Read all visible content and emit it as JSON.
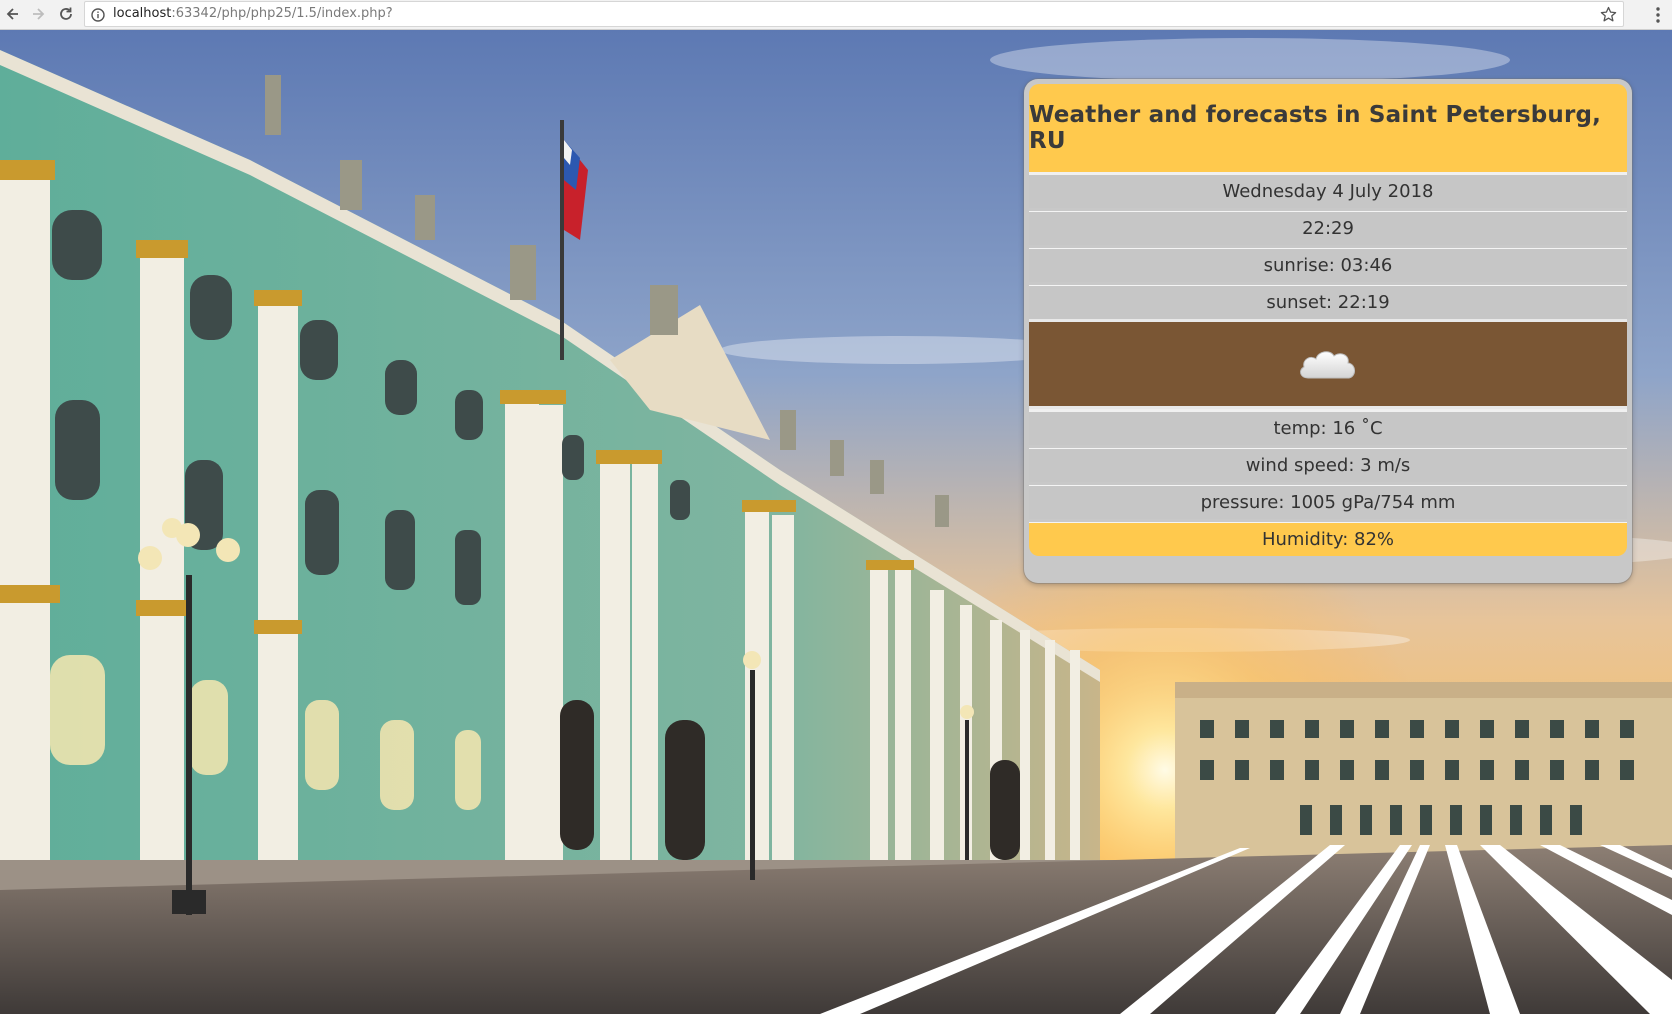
{
  "browser": {
    "url_host": "localhost",
    "url_rest": ":63342/php/php25/1.5/index.php?",
    "icons": [
      "back-icon",
      "forward-icon",
      "reload-icon",
      "info-icon",
      "star-icon",
      "menu-icon"
    ]
  },
  "weather": {
    "title": "Weather and forecasts in Saint Petersburg, RU",
    "date": "Wednesday 4 July 2018",
    "time": "22:29",
    "sunrise": "sunrise: 03:46",
    "sunset": "sunset: 22:19",
    "condition_icon": "cloud-icon",
    "temp": "temp: 16 ˚C",
    "wind": "wind speed: 3 m/s",
    "pressure": "pressure: 1005 gPa/754 mm",
    "humidity": "Humidity: 82%"
  },
  "colors": {
    "header_bg": "#ffc94d",
    "row_bg": "#c6c6c6",
    "icon_bg": "#7a5634",
    "humidity_bg": "#ffc94d"
  }
}
